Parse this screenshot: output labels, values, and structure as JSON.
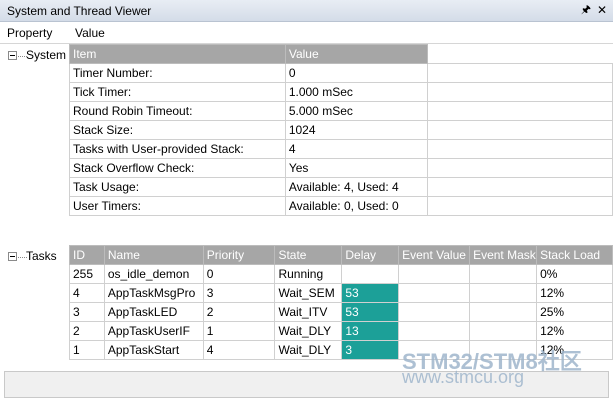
{
  "window": {
    "title": "System and Thread Viewer",
    "pin_icon": "pin-icon",
    "close_icon": "close-icon"
  },
  "columns": {
    "property": "Property",
    "value": "Value"
  },
  "tree": {
    "system": "System",
    "tasks": "Tasks"
  },
  "system_table": {
    "headers": [
      "Item",
      "Value"
    ],
    "rows": [
      [
        "Timer Number:",
        "0"
      ],
      [
        "Tick Timer:",
        "1.000 mSec"
      ],
      [
        "Round Robin Timeout:",
        "5.000 mSec"
      ],
      [
        "Stack Size:",
        "1024"
      ],
      [
        "Tasks with User-provided Stack:",
        "4"
      ],
      [
        "Stack Overflow Check:",
        "Yes"
      ],
      [
        "Task Usage:",
        "Available: 4, Used: 4"
      ],
      [
        "User Timers:",
        "Available: 0, Used: 0"
      ]
    ]
  },
  "tasks_table": {
    "headers": [
      "ID",
      "Name",
      "Priority",
      "State",
      "Delay",
      "Event Value",
      "Event Mask",
      "Stack Load"
    ],
    "rows": [
      [
        "255",
        "os_idle_demon",
        "0",
        "Running",
        "",
        "",
        "",
        "0%"
      ],
      [
        "4",
        "AppTaskMsgPro",
        "3",
        "Wait_SEM",
        "53",
        "",
        "",
        "12%"
      ],
      [
        "3",
        "AppTaskLED",
        "2",
        "Wait_ITV",
        "53",
        "",
        "",
        "25%"
      ],
      [
        "2",
        "AppTaskUserIF",
        "1",
        "Wait_DLY",
        "13",
        "",
        "",
        "12%"
      ],
      [
        "1",
        "AppTaskStart",
        "4",
        "Wait_DLY",
        "3",
        "",
        "",
        "12%"
      ]
    ],
    "delay_highlight_color": "#1ca098"
  },
  "watermark": {
    "line1": "STM32/STM8社区",
    "line2": "www.stmcu.org"
  }
}
